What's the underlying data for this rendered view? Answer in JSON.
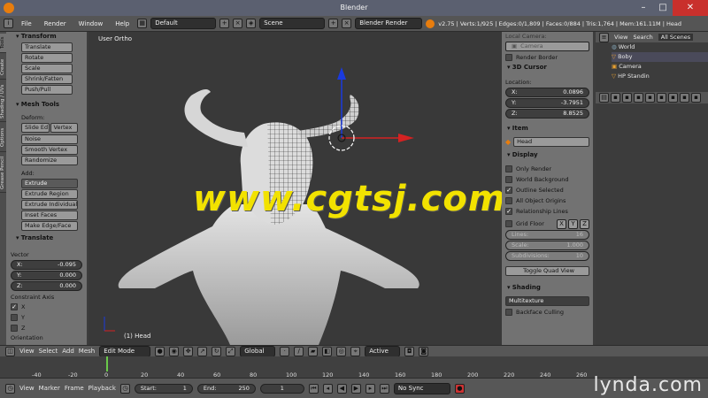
{
  "window": {
    "title": "Blender"
  },
  "menubar": {
    "items": [
      "File",
      "Render",
      "Window",
      "Help"
    ],
    "layout": "Default",
    "scene": "Scene",
    "engine": "Blender Render",
    "stats": "v2.75 | Verts:1/925 | Edges:0/1,809 | Faces:0/884 | Tris:1,764 | Mem:161.11M | Head"
  },
  "tool_tabs": [
    "Tools",
    "Create",
    "Shading / UVs",
    "Options",
    "Grease Pencil"
  ],
  "tools": {
    "transform_title": "Transform",
    "transform_buttons": [
      "Translate",
      "Rotate",
      "Scale",
      "Shrink/Fatten",
      "Push/Pull"
    ],
    "mesh_tools_title": "Mesh Tools",
    "deform_label": "Deform:",
    "deform_row": [
      "Slide Ed",
      "Vertex"
    ],
    "deform_buttons": [
      "Noise",
      "Smooth Vertex",
      "Randomize"
    ],
    "add_label": "Add:",
    "extrude": "Extrude",
    "add_buttons": [
      "Extrude Region",
      "Extrude Individual",
      "Inset Faces",
      "Make Edge/Face"
    ]
  },
  "translate_panel": {
    "title": "Translate",
    "vector_label": "Vector",
    "fields": [
      {
        "label": "X:",
        "value": "-0.095"
      },
      {
        "label": "Y:",
        "value": "0.000"
      },
      {
        "label": "Z:",
        "value": "0.000"
      }
    ],
    "constraint_label": "Constraint Axis",
    "constraints": [
      {
        "label": "X",
        "checked": true
      },
      {
        "label": "Y",
        "checked": false
      },
      {
        "label": "Z",
        "checked": false
      }
    ],
    "orientation_label": "Orientation"
  },
  "viewport": {
    "view_label": "User Ortho",
    "object_label": "(1) Head",
    "watermark": "www.cgtsj.com"
  },
  "n_panel": {
    "local_camera_label": "Local Camera:",
    "camera_field": "Camera",
    "render_border": "Render Border",
    "cursor_title": "3D Cursor",
    "location_label": "Location:",
    "cursor_fields": [
      {
        "label": "X:",
        "value": "0.0896"
      },
      {
        "label": "Y:",
        "value": "-3.7951"
      },
      {
        "label": "Z:",
        "value": "8.8525"
      }
    ],
    "item_title": "Item",
    "item_name": "Head",
    "display_title": "Display",
    "display_options": [
      {
        "label": "Only Render",
        "checked": false
      },
      {
        "label": "World Background",
        "checked": false
      },
      {
        "label": "Outline Selected",
        "checked": true
      },
      {
        "label": "All Object Origins",
        "checked": false
      },
      {
        "label": "Relationship Lines",
        "checked": true
      }
    ],
    "grid_floor": "Grid Floor",
    "grid_axes": [
      "X",
      "Y",
      "Z"
    ],
    "grid_fields": [
      {
        "label": "Lines:",
        "value": "16"
      },
      {
        "label": "Scale:",
        "value": "1.000"
      },
      {
        "label": "Subdivisions:",
        "value": "10"
      }
    ],
    "toggle_quad": "Toggle Quad View",
    "shading_title": "Shading",
    "shading_mode": "Multitexture",
    "backface": "Backface Culling"
  },
  "outliner": {
    "tabs": [
      "View",
      "Search",
      "All Scenes"
    ],
    "items": [
      "World",
      "Boby",
      "Camera",
      "HP Standin"
    ]
  },
  "viewport_header": {
    "menus": [
      "View",
      "Select",
      "Add",
      "Mesh"
    ],
    "mode": "Edit Mode",
    "orientation": "Global",
    "pivot": "Active"
  },
  "timeline": {
    "ticks": [
      "-40",
      "-20",
      "0",
      "20",
      "40",
      "60",
      "80",
      "100",
      "120",
      "140",
      "160",
      "180",
      "200",
      "220",
      "240",
      "260"
    ],
    "menus": [
      "View",
      "Marker",
      "Frame",
      "Playback"
    ],
    "start_label": "Start:",
    "start_value": "1",
    "end_label": "End:",
    "end_value": "250",
    "current_frame": "1",
    "sync": "No Sync"
  },
  "branding": {
    "logo": "lynda.com"
  },
  "colors": {
    "axis_x": "#d42222",
    "axis_y": "#22aa22",
    "axis_z": "#1a3adf",
    "watermark": "#f2e200"
  }
}
